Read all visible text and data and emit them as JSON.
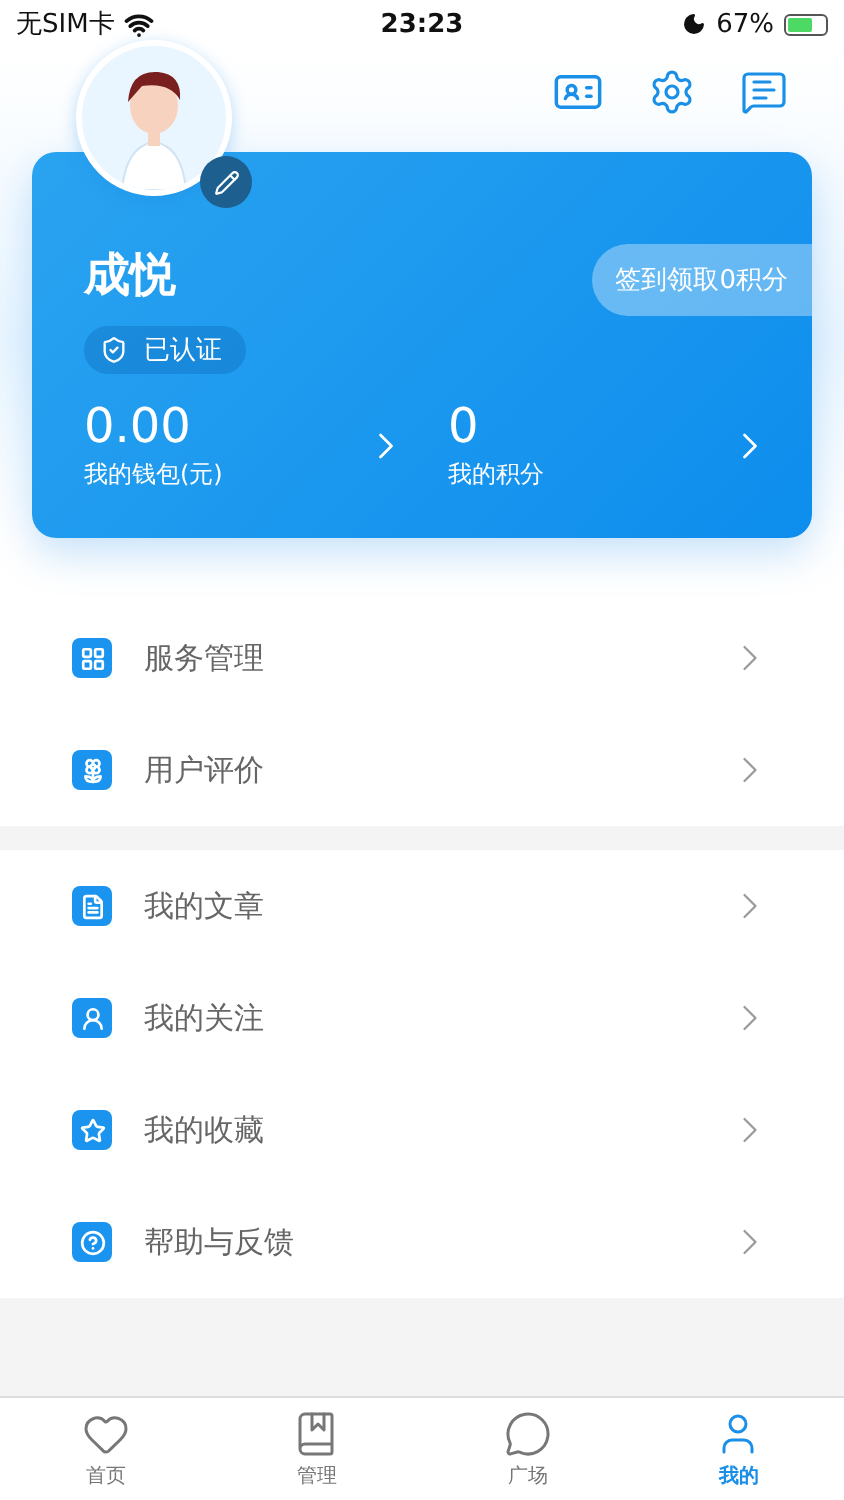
{
  "status_bar": {
    "carrier": "无SIM卡",
    "time": "23:23",
    "battery": "67%"
  },
  "profile": {
    "name": "成悦",
    "verified": "已认证",
    "checkin": "签到领取0积分",
    "stats": [
      {
        "value": "0.00",
        "label": "我的钱包(元)"
      },
      {
        "value": "0",
        "label": "我的积分"
      }
    ]
  },
  "menu_groups": [
    [
      {
        "label": "服务管理"
      },
      {
        "label": "用户评价"
      }
    ],
    [
      {
        "label": "我的文章"
      },
      {
        "label": "我的关注"
      },
      {
        "label": "我的收藏"
      },
      {
        "label": "帮助与反馈"
      }
    ]
  ],
  "tab_bar": [
    {
      "label": "首页",
      "selected": false
    },
    {
      "label": "管理",
      "selected": false
    },
    {
      "label": "广场",
      "selected": false
    },
    {
      "label": "我的",
      "selected": true
    }
  ]
}
